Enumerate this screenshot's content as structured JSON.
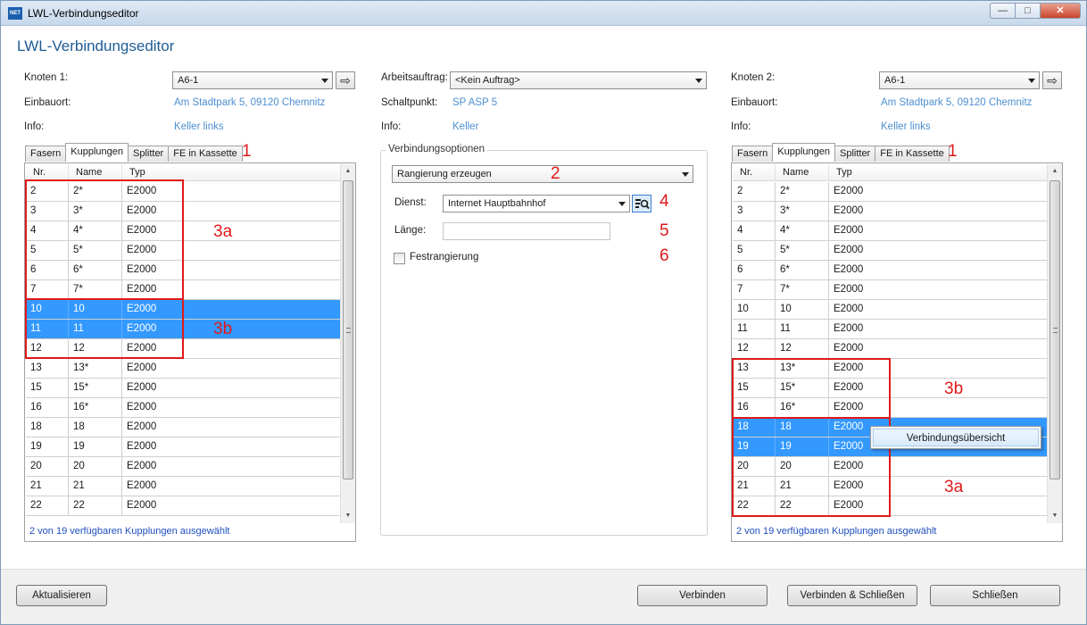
{
  "window": {
    "title": "LWL-Verbindungseditor",
    "app_icon_text": "NET"
  },
  "heading": "LWL-Verbindungseditor",
  "left": {
    "knoten_label": "Knoten 1:",
    "knoten_value": "A6-1",
    "einbauort_label": "Einbauort:",
    "einbauort_value": "Am Stadtpark 5, 09120 Chemnitz",
    "info_label": "Info:",
    "info_value": "Keller links",
    "tabs": [
      "Fasern",
      "Kupplungen",
      "Splitter",
      "FE in Kassette"
    ],
    "active_tab": 1,
    "columns": [
      "Nr.",
      "Name",
      "Typ"
    ],
    "rows": [
      [
        "2",
        "2*",
        "E2000"
      ],
      [
        "3",
        "3*",
        "E2000"
      ],
      [
        "4",
        "4*",
        "E2000"
      ],
      [
        "5",
        "5*",
        "E2000"
      ],
      [
        "6",
        "6*",
        "E2000"
      ],
      [
        "7",
        "7*",
        "E2000"
      ],
      [
        "10",
        "10",
        "E2000"
      ],
      [
        "11",
        "11",
        "E2000"
      ],
      [
        "12",
        "12",
        "E2000"
      ],
      [
        "13",
        "13*",
        "E2000"
      ],
      [
        "15",
        "15*",
        "E2000"
      ],
      [
        "16",
        "16*",
        "E2000"
      ],
      [
        "18",
        "18",
        "E2000"
      ],
      [
        "19",
        "19",
        "E2000"
      ],
      [
        "20",
        "20",
        "E2000"
      ],
      [
        "21",
        "21",
        "E2000"
      ],
      [
        "22",
        "22",
        "E2000"
      ]
    ],
    "selected_rows": [
      6,
      7
    ],
    "status": "2 von 19 verfügbaren Kupplungen ausgewählt"
  },
  "center": {
    "auftrag_label": "Arbeitsauftrag:",
    "auftrag_value": "<Kein Auftrag>",
    "schaltpunkt_label": "Schaltpunkt:",
    "schaltpunkt_value": "SP ASP 5",
    "info_label": "Info:",
    "info_value": "Keller",
    "group_title": "Verbindungsoptionen",
    "mode_value": "Rangierung erzeugen",
    "dienst_label": "Dienst:",
    "dienst_value": "Internet Hauptbahnhof",
    "laenge_label": "Länge:",
    "laenge_value": "",
    "fest_label": "Festrangierung",
    "fest_checked": false
  },
  "right": {
    "knoten_label": "Knoten 2:",
    "knoten_value": "A6-1",
    "einbauort_label": "Einbauort:",
    "einbauort_value": "Am Stadtpark 5, 09120 Chemnitz",
    "info_label": "Info:",
    "info_value": "Keller links",
    "tabs": [
      "Fasern",
      "Kupplungen",
      "Splitter",
      "FE in Kassette"
    ],
    "active_tab": 1,
    "columns": [
      "Nr.",
      "Name",
      "Typ"
    ],
    "rows": [
      [
        "2",
        "2*",
        "E2000"
      ],
      [
        "3",
        "3*",
        "E2000"
      ],
      [
        "4",
        "4*",
        "E2000"
      ],
      [
        "5",
        "5*",
        "E2000"
      ],
      [
        "6",
        "6*",
        "E2000"
      ],
      [
        "7",
        "7*",
        "E2000"
      ],
      [
        "10",
        "10",
        "E2000"
      ],
      [
        "11",
        "11",
        "E2000"
      ],
      [
        "12",
        "12",
        "E2000"
      ],
      [
        "13",
        "13*",
        "E2000"
      ],
      [
        "15",
        "15*",
        "E2000"
      ],
      [
        "16",
        "16*",
        "E2000"
      ],
      [
        "18",
        "18",
        "E2000"
      ],
      [
        "19",
        "19",
        "E2000"
      ],
      [
        "20",
        "20",
        "E2000"
      ],
      [
        "21",
        "21",
        "E2000"
      ],
      [
        "22",
        "22",
        "E2000"
      ]
    ],
    "selected_rows": [
      12,
      13
    ],
    "context_menu_item": "Verbindungsübersicht",
    "status": "2 von 19 verfügbaren Kupplungen ausgewählt"
  },
  "annotations": {
    "n1": "1",
    "n2": "2",
    "n3a": "3a",
    "n3b": "3b",
    "n4": "4",
    "n5": "5",
    "n6": "6",
    "color": "#e0191a"
  },
  "footer": {
    "refresh": "Aktualisieren",
    "connect": "Verbinden",
    "connect_close": "Verbinden & Schließen",
    "close": "Schließen"
  },
  "colors": {
    "heading": "#1e5c94",
    "link": "#4d8fd1",
    "selection": "#3399ff",
    "status": "#1f4fbf"
  }
}
